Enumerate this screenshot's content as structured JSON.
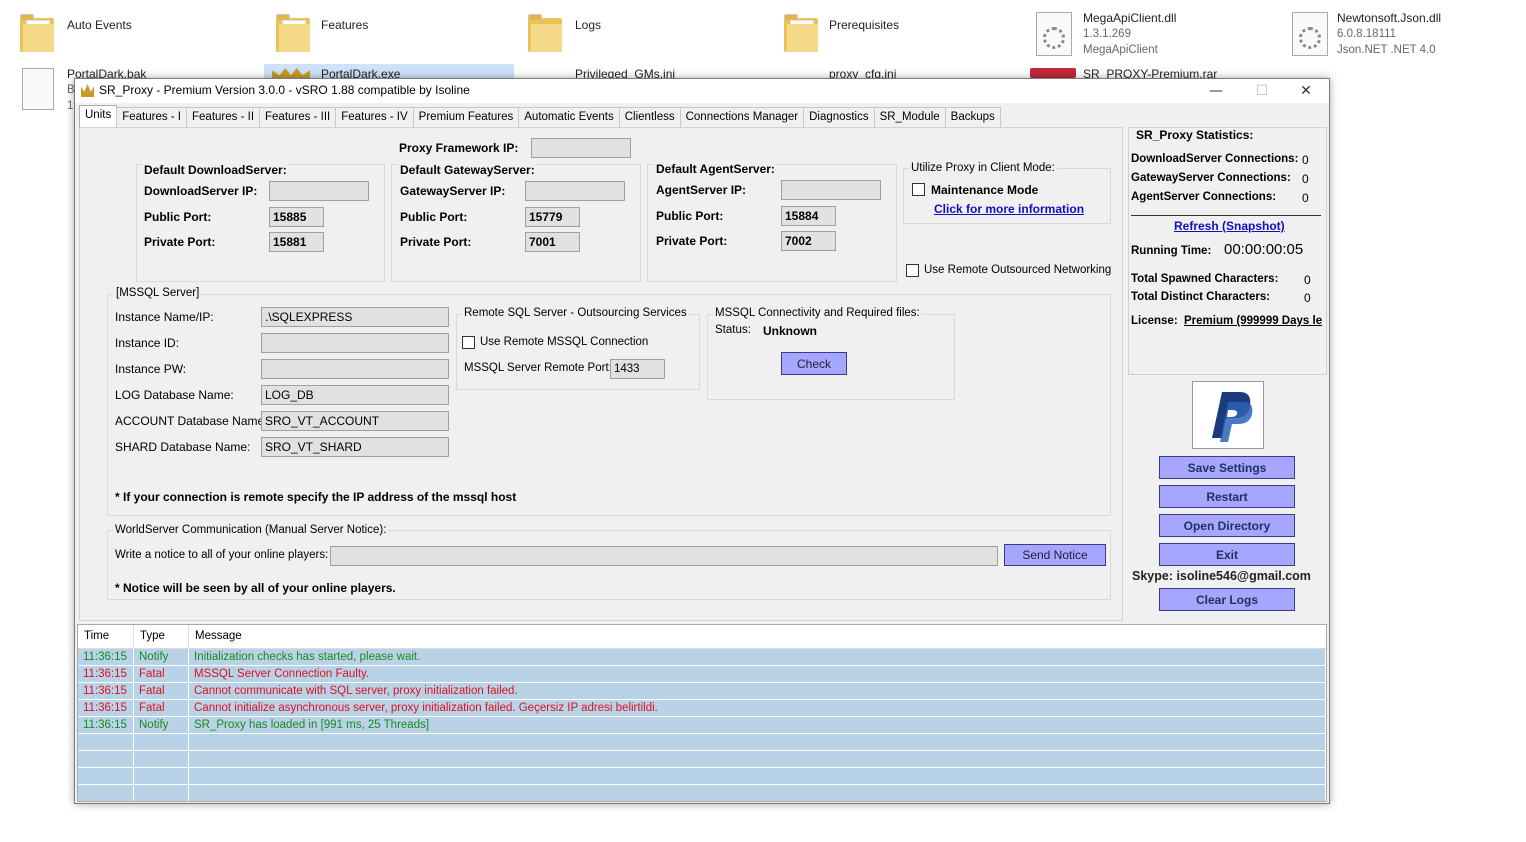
{
  "desktop": {
    "row1": [
      {
        "name": "Auto Events",
        "type": "folder"
      },
      {
        "name": "Features",
        "type": "folder"
      },
      {
        "name": "Logs",
        "type": "folder"
      },
      {
        "name": "Prerequisites",
        "type": "folder"
      },
      {
        "name": "MegaApiClient.dll",
        "sub1": "1.3.1.269",
        "sub2": "MegaApiClient",
        "type": "dll"
      },
      {
        "name": "Newtonsoft.Json.dll",
        "sub1": "6.0.8.18111",
        "sub2": "Json.NET .NET 4.0",
        "type": "dll"
      }
    ],
    "row2": [
      {
        "name": "PortalDark.bak",
        "sub1": "B",
        "sub2": "1"
      },
      {
        "name": "PortalDark.exe"
      },
      {
        "name": "Privileged_GMs.ini"
      },
      {
        "name": "proxy_cfg.ini"
      },
      {
        "name": "SR_PROXY-Premium.rar"
      }
    ]
  },
  "window": {
    "title": "SR_Proxy - Premium Version 3.0.0 - vSRO 1.88 compatible by Isoline",
    "minimize": "—",
    "maximize": "☐",
    "close": "✕"
  },
  "tabs": [
    "Units",
    "Features - I",
    "Features - II",
    "Features - III",
    "Features - IV",
    "Premium Features",
    "Automatic Events",
    "Clientless",
    "Connections Manager",
    "Diagnostics",
    "SR_Module",
    "Backups"
  ],
  "units": {
    "proxy_framework_label": "Proxy Framework IP:",
    "proxy_framework_value": "",
    "download": {
      "title": "Default DownloadServer:",
      "ip_label": "DownloadServer IP:",
      "ip": "",
      "public_label": "Public Port:",
      "public": "15885",
      "private_label": "Private Port:",
      "private": "15881"
    },
    "gateway": {
      "title": "Default GatewayServer:",
      "ip_label": "GatewayServer IP:",
      "ip": "",
      "public_label": "Public Port:",
      "public": "15779",
      "private_label": "Private Port:",
      "private": "7001"
    },
    "agent": {
      "title": "Default AgentServer:",
      "ip_label": "AgentServer IP:",
      "ip": "",
      "public_label": "Public Port:",
      "public": "15884",
      "private_label": "Private Port:",
      "private": "7002"
    },
    "client_mode": {
      "title": "Utilize Proxy in Client Mode:",
      "maintenance": "Maintenance Mode",
      "link": "Click for more information"
    },
    "remote_networking": "Use Remote Outsourced Networking",
    "mssql": {
      "title": "[MSSQL Server]",
      "instance_label": "Instance Name/IP:",
      "instance": ".\\SQLEXPRESS",
      "id_label": "Instance ID:",
      "id": "",
      "pw_label": "Instance PW:",
      "pw": "",
      "log_label": "LOG Database Name:",
      "log": "LOG_DB",
      "account_label": "ACCOUNT Database Name:",
      "account": "SRO_VT_ACCOUNT",
      "shard_label": "SHARD Database Name:",
      "shard": "SRO_VT_SHARD",
      "note": "* If your connection is remote specify the IP address of the mssql host"
    },
    "remote_sql": {
      "title": "Remote SQL Server -  Outsourcing Services",
      "use_remote": "Use Remote MSSQL Connection",
      "port_label": "MSSQL Server Remote Port:",
      "port": "1433"
    },
    "connectivity": {
      "title": "MSSQL Connectivity and Required files:",
      "status_label": "Status:",
      "status": "Unknown",
      "check": "Check"
    },
    "notice": {
      "title": "WorldServer Communication (Manual Server Notice):",
      "label": "Write a notice to all of your online players:",
      "value": "",
      "send": "Send Notice",
      "note": "* Notice will be seen by all of your online players."
    }
  },
  "stats": {
    "title": "SR_Proxy Statistics:",
    "download_label": "DownloadServer Connections:",
    "download": "0",
    "gateway_label": "GatewayServer Connections:",
    "gateway": "0",
    "agent_label": "AgentServer Connections:",
    "agent": "0",
    "refresh": "Refresh (Snapshot)",
    "running_label": "Running Time:",
    "running": "00:00:00:05",
    "spawned_label": "Total Spawned Characters:",
    "spawned": "0",
    "distinct_label": "Total Distinct Characters:",
    "distinct": "0",
    "license_label": "License:",
    "license": "Premium (999999 Days le"
  },
  "actions": {
    "save": "Save Settings",
    "restart": "Restart",
    "open_dir": "Open Directory",
    "exit": "Exit",
    "skype": "Skype: isoline546@gmail.com",
    "clear_logs": "Clear Logs"
  },
  "log": {
    "headers": [
      "Time",
      "Type",
      "Message"
    ],
    "rows": [
      {
        "time": "11:36:15",
        "type": "Notify",
        "message": "Initialization checks has started, please wait."
      },
      {
        "time": "11:36:15",
        "type": "Fatal",
        "message": "MSSQL Server Connection Faulty."
      },
      {
        "time": "11:36:15",
        "type": "Fatal",
        "message": "Cannot communicate with SQL server, proxy initialization failed."
      },
      {
        "time": "11:36:15",
        "type": "Fatal",
        "message": "Cannot initialize asynchronous server, proxy initialization failed. Geçersiz IP adresi belirtildi."
      },
      {
        "time": "11:36:15",
        "type": "Notify",
        "message": "SR_Proxy has loaded in [991 ms, 25 Threads]"
      }
    ]
  },
  "colors": {
    "button": "#a6a6ff",
    "log_row": "#b8d2e8",
    "notify": "#1a8a1a",
    "fatal": "#e01020",
    "link": "#1010c0"
  }
}
